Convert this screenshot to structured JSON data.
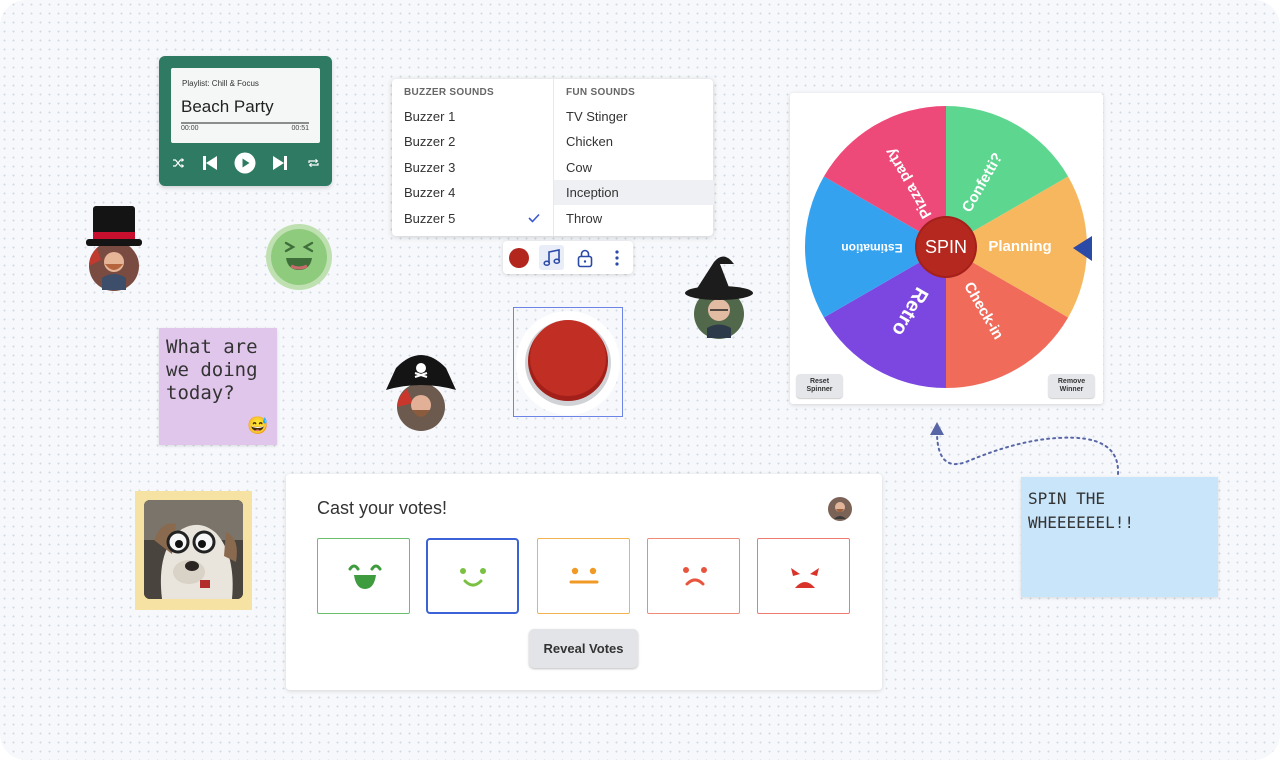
{
  "player": {
    "playlist": "Playlist: Chill & Focus",
    "track": "Beach Party",
    "progress": 0,
    "time_current": "00:00",
    "time_total": "00:51",
    "controls": [
      "shuffle-icon",
      "previous-icon",
      "play-icon",
      "next-icon",
      "repeat-icon"
    ],
    "bg_color": "#2f7a63"
  },
  "sounds_menu": {
    "buzzer_header": "BUZZER SOUNDS",
    "buzzer_items": [
      "Buzzer 1",
      "Buzzer 2",
      "Buzzer 3",
      "Buzzer 4",
      "Buzzer 5"
    ],
    "buzzer_selected": "Buzzer 5",
    "fun_header": "FUN SOUNDS",
    "fun_items": [
      "TV Stinger",
      "Chicken",
      "Cow",
      "Inception",
      "Throw"
    ],
    "fun_highlighted": "Inception"
  },
  "toolbar": {
    "buttons": [
      "color-swatch",
      "music-note-icon",
      "lock-icon",
      "more-vertical-icon"
    ],
    "color": "#b3261e",
    "active": "music-note-icon"
  },
  "sticky_purple": {
    "text": "What are we doing today?",
    "emoji": "😅",
    "color": "#e1c6ec"
  },
  "sticky_blue": {
    "text": "SPIN THE WHEEEEEEL!!",
    "color": "#c9e5fa"
  },
  "votes": {
    "title": "Cast your votes!",
    "options": [
      {
        "face": "very-happy",
        "color": "#5cb85c"
      },
      {
        "face": "happy",
        "color": "#7ac143"
      },
      {
        "face": "neutral",
        "color": "#f0a030"
      },
      {
        "face": "sad",
        "color": "#e8553f"
      },
      {
        "face": "angry",
        "color": "#d9342b"
      }
    ],
    "selected_index": 1,
    "reveal_label": "Reveal Votes"
  },
  "spinner": {
    "center_label": "SPIN",
    "segments": [
      {
        "label": "Confetti?",
        "color": "#5dd68f"
      },
      {
        "label": "Planning",
        "color": "#f7b75e"
      },
      {
        "label": "Check-in",
        "color": "#f06b5a"
      },
      {
        "label": "Retro",
        "color": "#7b47e0"
      },
      {
        "label": "Estimation",
        "color": "#35a2f0"
      },
      {
        "label": "Pizza party",
        "color": "#ee4a79"
      }
    ],
    "reset_label": "Reset Spinner",
    "remove_label": "Remove Winner"
  }
}
